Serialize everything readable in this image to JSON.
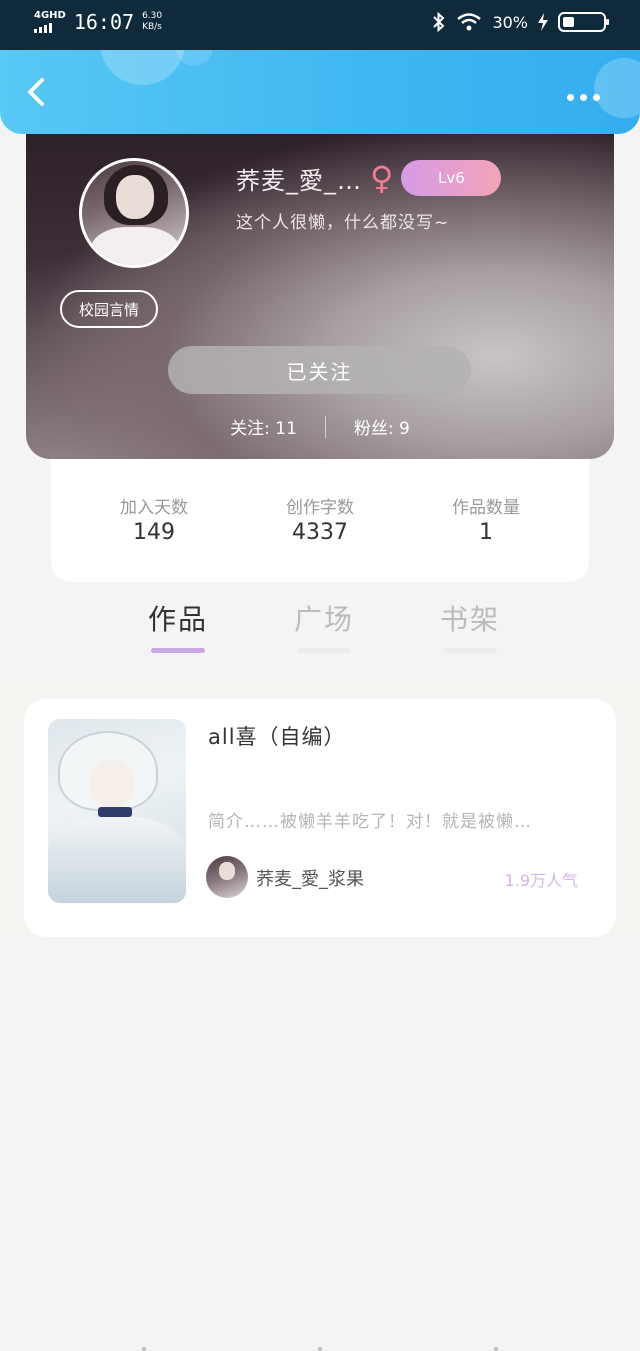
{
  "status_bar": {
    "network": "4GHD",
    "time": "16:07",
    "speed_value": "6.30",
    "speed_unit": "KB/s",
    "battery_text": "30%",
    "battery_level": 0.3
  },
  "header": {
    "back_icon": "chevron-left-icon",
    "more_icon": "more-dots-icon"
  },
  "profile": {
    "name": "荞麦_愛_…",
    "gender_symbol": "♀",
    "level": "Lv6",
    "bio": "这个人很懒，什么都没写~",
    "tag": "校园言情",
    "follow_button": "已关注",
    "following": "关注: 11",
    "followers": "粉丝: 9"
  },
  "stats": [
    {
      "label": "加入天数",
      "value": "149"
    },
    {
      "label": "创作字数",
      "value": "4337"
    },
    {
      "label": "作品数量",
      "value": "1"
    }
  ],
  "tabs": [
    {
      "label": "作品",
      "active": true
    },
    {
      "label": "广场",
      "active": false
    },
    {
      "label": "书架",
      "active": false
    }
  ],
  "works": [
    {
      "title": "all喜（自编）",
      "intro": "简介……被懒羊羊吃了！对！就是被懒…",
      "author": "荞麦_愛_浆果",
      "popularity": "1.9万人气"
    }
  ],
  "colors": {
    "header_blue": "#3fb6f1",
    "level_gradient_start": "#d59be6",
    "level_gradient_end": "#f4a3b8",
    "tab_active_bar": "#c9a7e3",
    "popularity_text": "#d4b5ea",
    "gender_pink": "#f07b92"
  }
}
